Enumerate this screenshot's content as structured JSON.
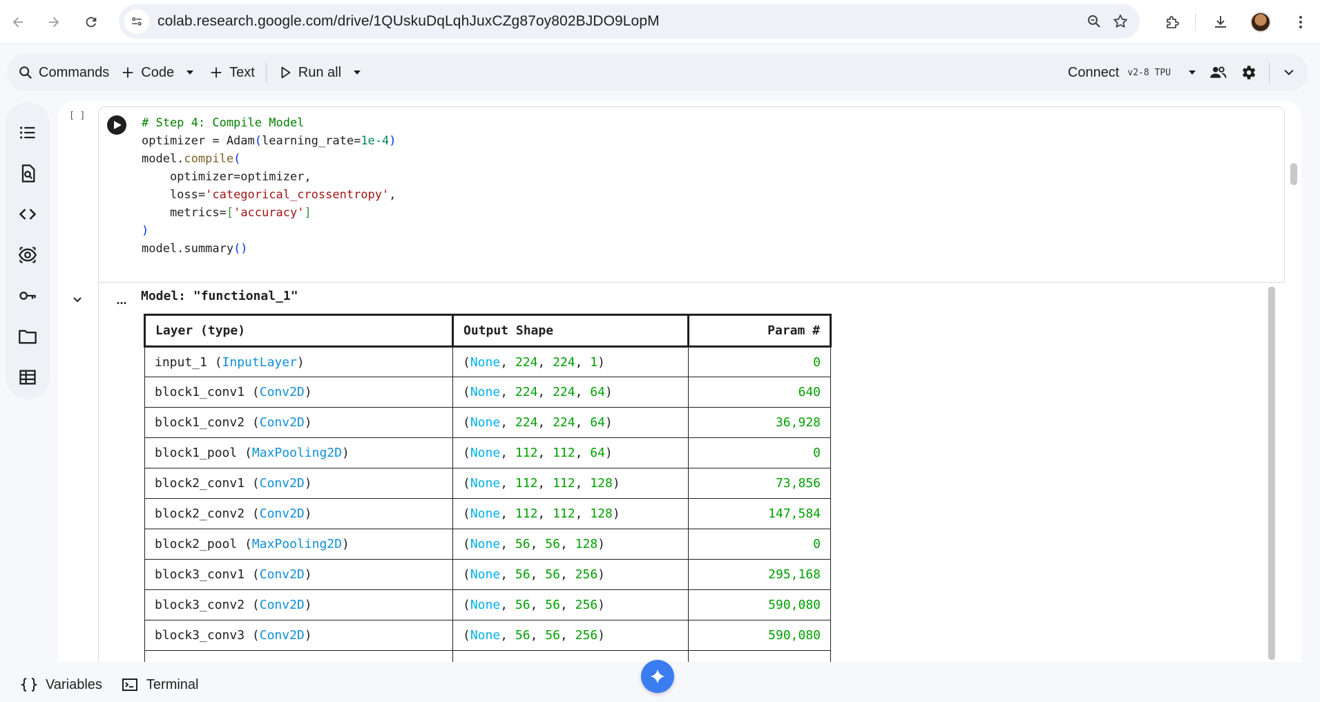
{
  "browser": {
    "url": "colab.research.google.com/drive/1QUskuDqLqhJuxCZg87oy802BJDO9LopM"
  },
  "toolbar": {
    "commands_label": "Commands",
    "code_label": "Code",
    "text_label": "Text",
    "run_all_label": "Run all",
    "connect_label": "Connect",
    "runtime_label": "v2-8 TPU"
  },
  "sidebar": {
    "items": [
      {
        "icon": "table-of-contents-icon"
      },
      {
        "icon": "find-replace-icon"
      },
      {
        "icon": "code-snippets-icon"
      },
      {
        "icon": "variables-inspector-icon"
      },
      {
        "icon": "secrets-key-icon"
      },
      {
        "icon": "files-folder-icon"
      },
      {
        "icon": "data-table-icon"
      }
    ]
  },
  "cell": {
    "execution_count": "[ ]",
    "code_lines": [
      "# Step 4: Compile Model",
      "optimizer = Adam(learning_rate=1e-4)",
      "model.compile(",
      "    optimizer=optimizer,",
      "    loss='categorical_crossentropy',",
      "    metrics=['accuracy']",
      ")",
      "model.summary()"
    ]
  },
  "output": {
    "ellipsis": "...",
    "model_title": "Model: \"functional_1\"",
    "table": {
      "headers": [
        "Layer (type)",
        "Output Shape",
        "Param #"
      ],
      "rows": [
        {
          "name": "input_1",
          "type": "InputLayer",
          "shape": [
            "None",
            "224",
            "224",
            "1"
          ],
          "params": "0"
        },
        {
          "name": "block1_conv1",
          "type": "Conv2D",
          "shape": [
            "None",
            "224",
            "224",
            "64"
          ],
          "params": "640"
        },
        {
          "name": "block1_conv2",
          "type": "Conv2D",
          "shape": [
            "None",
            "224",
            "224",
            "64"
          ],
          "params": "36,928"
        },
        {
          "name": "block1_pool",
          "type": "MaxPooling2D",
          "shape": [
            "None",
            "112",
            "112",
            "64"
          ],
          "params": "0"
        },
        {
          "name": "block2_conv1",
          "type": "Conv2D",
          "shape": [
            "None",
            "112",
            "112",
            "128"
          ],
          "params": "73,856"
        },
        {
          "name": "block2_conv2",
          "type": "Conv2D",
          "shape": [
            "None",
            "112",
            "112",
            "128"
          ],
          "params": "147,584"
        },
        {
          "name": "block2_pool",
          "type": "MaxPooling2D",
          "shape": [
            "None",
            "56",
            "56",
            "128"
          ],
          "params": "0"
        },
        {
          "name": "block3_conv1",
          "type": "Conv2D",
          "shape": [
            "None",
            "56",
            "56",
            "256"
          ],
          "params": "295,168"
        },
        {
          "name": "block3_conv2",
          "type": "Conv2D",
          "shape": [
            "None",
            "56",
            "56",
            "256"
          ],
          "params": "590,080"
        },
        {
          "name": "block3_conv3",
          "type": "Conv2D",
          "shape": [
            "None",
            "56",
            "56",
            "256"
          ],
          "params": "590,080"
        }
      ]
    }
  },
  "bottom_bar": {
    "variables_label": "Variables",
    "terminal_label": "Terminal"
  },
  "colors": {
    "accent_blue": "#3b7cf0",
    "layer_type": "#0f8fd8",
    "none_value": "#00b0e8",
    "number_value": "#00a000"
  }
}
